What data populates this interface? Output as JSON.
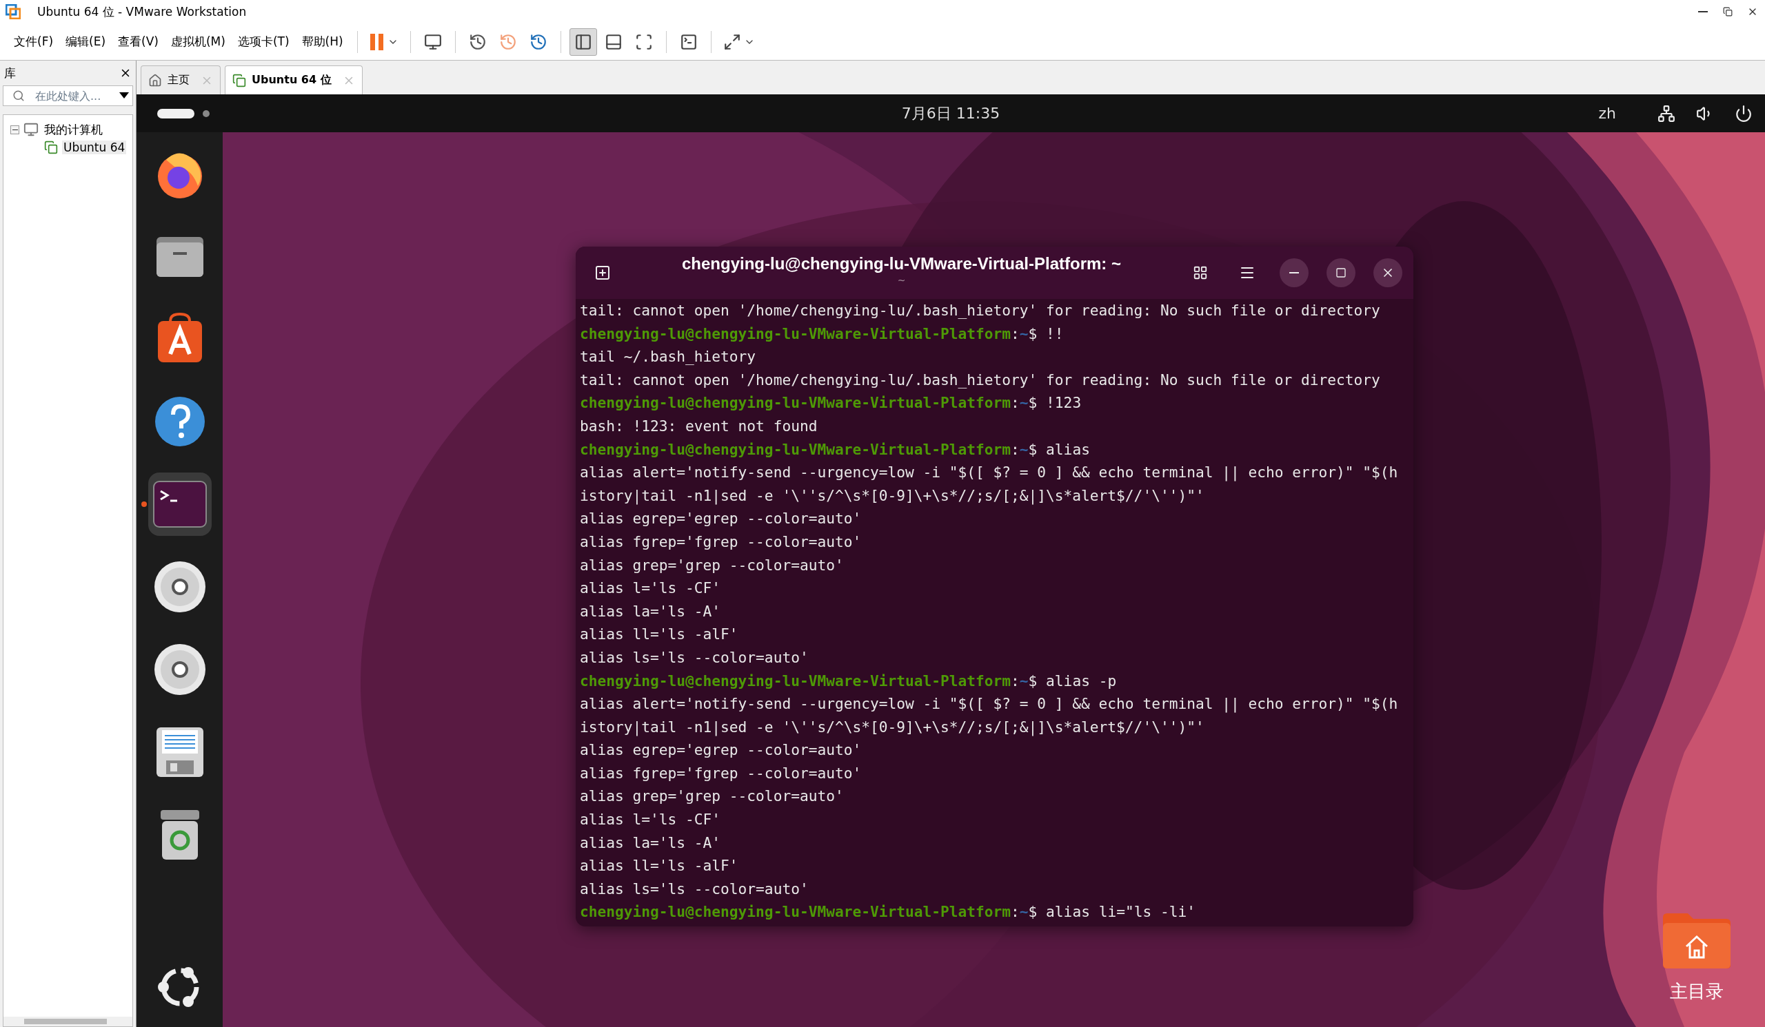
{
  "window": {
    "title": "Ubuntu 64 位 - VMware Workstation"
  },
  "menu": [
    "文件(F)",
    "编辑(E)",
    "查看(V)",
    "虚拟机(M)",
    "选项卡(T)",
    "帮助(H)"
  ],
  "toolbar": [
    {
      "kind": "pause",
      "pressed": false
    },
    {
      "kind": "send-keys",
      "pressed": false
    },
    {
      "kind": "snapshot-take",
      "pressed": false
    },
    {
      "kind": "snapshot-revert",
      "pressed": false
    },
    {
      "kind": "snapshot-manage",
      "pressed": false
    },
    {
      "kind": "view-library",
      "pressed": true
    },
    {
      "kind": "view-thumbnail",
      "pressed": false
    },
    {
      "kind": "view-fit",
      "pressed": false
    },
    {
      "kind": "console",
      "pressed": false
    },
    {
      "kind": "fullscreen",
      "pressed": false
    }
  ],
  "library": {
    "title": "库",
    "search": {
      "placeholder": "在此处键入..."
    },
    "tree": [
      {
        "label": "我的计算机",
        "expanded": true,
        "selected": false,
        "children": [
          {
            "label": "Ubuntu 64",
            "selected": true
          }
        ]
      }
    ]
  },
  "tabs": [
    {
      "label": "主页",
      "kind": "home",
      "selected": false
    },
    {
      "label": "Ubuntu 64 位",
      "kind": "vm",
      "selected": true
    }
  ],
  "ubuntu": {
    "clock": "7月6日 11:35",
    "input_method": "zh"
  },
  "dock": [
    {
      "kind": "firefox",
      "running": false
    },
    {
      "kind": "files",
      "running": false
    },
    {
      "kind": "store",
      "running": false
    },
    {
      "kind": "help",
      "running": false
    },
    {
      "kind": "terminal",
      "running": true
    },
    {
      "kind": "disc",
      "running": false
    },
    {
      "kind": "disc",
      "running": false
    },
    {
      "kind": "save",
      "running": false
    },
    {
      "kind": "trash",
      "running": false
    },
    {
      "kind": "apps",
      "running": false
    }
  ],
  "terminal": {
    "title": "chengying-lu@chengying-lu-VMware-Virtual-Platform: ~",
    "subtitle": "~",
    "lines": [
      {
        "kind": "output",
        "text": "tail: cannot open '/home/chengying-lu/.bash_hietory' for reading: No such file or directory"
      },
      {
        "kind": "prompt",
        "user": "chengying-lu@chengying-lu-VMware-Virtual-Platform",
        "sep": ":",
        "path": "~",
        "symbol": "$",
        "command": "!!"
      },
      {
        "kind": "output",
        "text": "tail ~/.bash_hietory"
      },
      {
        "kind": "output",
        "text": "tail: cannot open '/home/chengying-lu/.bash_hietory' for reading: No such file or directory"
      },
      {
        "kind": "prompt",
        "user": "chengying-lu@chengying-lu-VMware-Virtual-Platform",
        "sep": ":",
        "path": "~",
        "symbol": "$",
        "command": "!123"
      },
      {
        "kind": "output",
        "text": "bash: !123: event not found"
      },
      {
        "kind": "prompt",
        "user": "chengying-lu@chengying-lu-VMware-Virtual-Platform",
        "sep": ":",
        "path": "~",
        "symbol": "$",
        "command": "alias"
      },
      {
        "kind": "output",
        "text": "alias alert='notify-send --urgency=low -i \"$([ $? = 0 ] && echo terminal || echo error)\" \"$(h"
      },
      {
        "kind": "output",
        "text": "istory|tail -n1|sed -e '\\''s/^\\s*[0-9]\\+\\s*//;s/[;&|]\\s*alert$//'\\'')\"'"
      },
      {
        "kind": "output",
        "text": "alias egrep='egrep --color=auto'"
      },
      {
        "kind": "output",
        "text": "alias fgrep='fgrep --color=auto'"
      },
      {
        "kind": "output",
        "text": "alias grep='grep --color=auto'"
      },
      {
        "kind": "output",
        "text": "alias l='ls -CF'"
      },
      {
        "kind": "output",
        "text": "alias la='ls -A'"
      },
      {
        "kind": "output",
        "text": "alias ll='ls -alF'"
      },
      {
        "kind": "output",
        "text": "alias ls='ls --color=auto'"
      },
      {
        "kind": "prompt",
        "user": "chengying-lu@chengying-lu-VMware-Virtual-Platform",
        "sep": ":",
        "path": "~",
        "symbol": "$",
        "command": "alias -p"
      },
      {
        "kind": "output",
        "text": "alias alert='notify-send --urgency=low -i \"$([ $? = 0 ] && echo terminal || echo error)\" \"$(h"
      },
      {
        "kind": "output",
        "text": "istory|tail -n1|sed -e '\\''s/^\\s*[0-9]\\+\\s*//;s/[;&|]\\s*alert$//'\\'')\"'"
      },
      {
        "kind": "output",
        "text": "alias egrep='egrep --color=auto'"
      },
      {
        "kind": "output",
        "text": "alias fgrep='fgrep --color=auto'"
      },
      {
        "kind": "output",
        "text": "alias grep='grep --color=auto'"
      },
      {
        "kind": "output",
        "text": "alias l='ls -CF'"
      },
      {
        "kind": "output",
        "text": "alias la='ls -A'"
      },
      {
        "kind": "output",
        "text": "alias ll='ls -alF'"
      },
      {
        "kind": "output",
        "text": "alias ls='ls --color=auto'"
      },
      {
        "kind": "prompt",
        "user": "chengying-lu@chengying-lu-VMware-Virtual-Platform",
        "sep": ":",
        "path": "~",
        "symbol": "$",
        "command": "alias li=\"ls -li'"
      }
    ]
  },
  "desktop_icons": [
    {
      "label": "主目录"
    }
  ]
}
